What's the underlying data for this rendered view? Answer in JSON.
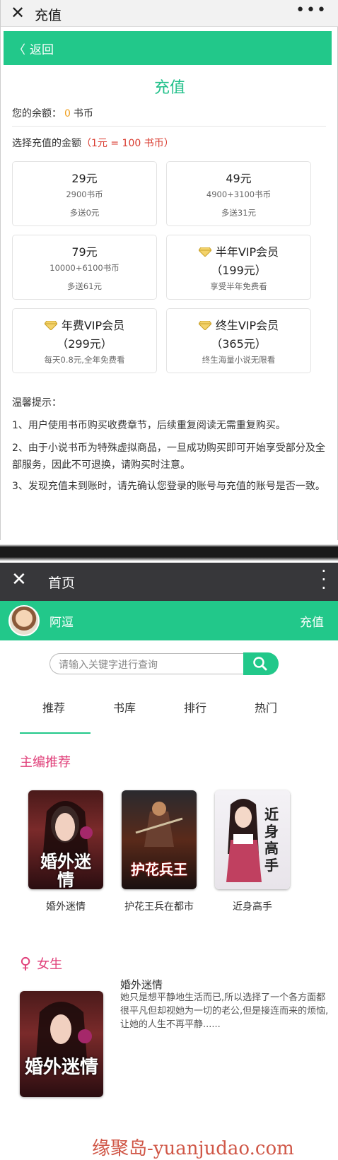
{
  "top": {
    "window_title": "充值",
    "back_label": "返回",
    "page_title": "充值",
    "balance_label": "您的余额：",
    "balance_value": "0",
    "balance_unit": "书币",
    "choose_label": "选择充值的金额",
    "rate_note": "（1元 = 100 书币）",
    "cards": [
      {
        "price": "29元",
        "line2": "2900书币",
        "line3": "多送0元"
      },
      {
        "price": "49元",
        "line2": "4900+3100书币",
        "line3": "多送31元"
      },
      {
        "price": "79元",
        "line2": "10000+6100书币",
        "line3": "多送61元"
      },
      {
        "price": "半年VIP会员",
        "line2": "（199元）",
        "line3": "享受半年免费看"
      },
      {
        "price": "年费VIP会员",
        "line2": "（299元）",
        "line3": "每天0.8元,全年免费看"
      },
      {
        "price": "终生VIP会员",
        "line2": "（365元）",
        "line3": "终生海量小说无限看"
      }
    ],
    "tips_title": "温馨提示：",
    "tips": [
      "1、用户使用书币购买收费章节，后续重复阅读无需重复购买。",
      "2、由于小说书币为特殊虚拟商品，一旦成功购买即可开始享受部分及全部服务，因此不可退换，请购买时注意。",
      "3、发现充值未到账时，请先确认您登录的账号与充值的账号是否一致。"
    ]
  },
  "bottom": {
    "window_title": "首页",
    "username": "阿逗",
    "recharge_label": "充值",
    "search_placeholder": "请输入关键字进行查询",
    "tabs": [
      "推荐",
      "书库",
      "排行",
      "热门"
    ],
    "section_editor": "主编推荐",
    "books": [
      {
        "title": "婚外迷情",
        "cover_text": "婚外迷情"
      },
      {
        "title": "护花王兵在都市",
        "cover_text": "护花兵王"
      },
      {
        "title": "近身高手",
        "cover_text": "近身高手"
      }
    ],
    "section_female": "女生",
    "featured": {
      "title": "婚外迷情",
      "desc": "她只是想平静地生活而已,所以选择了一个各方面都很平凡但却视她为一切的老公,但是接连而来的烦恼,让她的人生不再平静......",
      "cover_text": "婚外迷情"
    }
  },
  "watermark": "缘聚岛-yuanjudao.com",
  "colors": {
    "green": "#22c88a",
    "pink": "#e0407a",
    "orange": "#f0a020",
    "red": "#d93a2e",
    "dark": "#37373a"
  }
}
